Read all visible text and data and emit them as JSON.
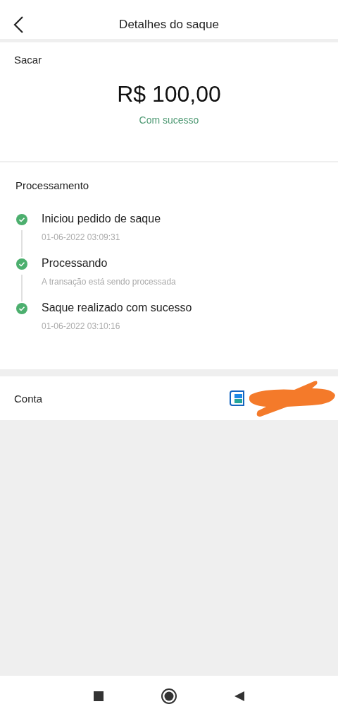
{
  "header": {
    "title": "Detalhes do saque"
  },
  "amount_card": {
    "label": "Sacar",
    "amount": "R$ 100,00",
    "status": "Com sucesso"
  },
  "processing": {
    "title": "Processamento",
    "steps": [
      {
        "title": "Iniciou pedido de saque",
        "detail": "01-06-2022 03:09:31",
        "done": true
      },
      {
        "title": "Processando",
        "detail": "A transação está sendo processada",
        "done": true
      },
      {
        "title": "Saque realizado com sucesso",
        "detail": "01-06-2022 03:10:16",
        "done": true
      }
    ]
  },
  "account": {
    "label": "Conta",
    "redacted": true
  }
}
